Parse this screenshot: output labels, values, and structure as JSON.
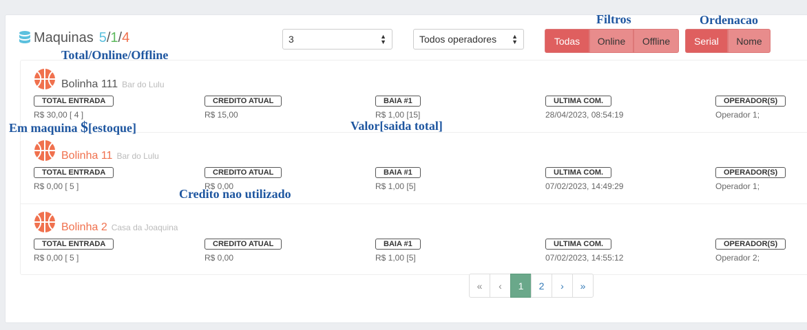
{
  "header": {
    "title": "Maquinas",
    "count_total": "5",
    "count_online": "1",
    "count_offline": "4",
    "separator": "/"
  },
  "filters": {
    "quantity_select": "3",
    "operator_select": "Todos operadores",
    "status_buttons": [
      "Todas",
      "Online",
      "Offline"
    ],
    "order_buttons": [
      "Serial",
      "Nome"
    ]
  },
  "labels": {
    "total_entrada": "TOTAL ENTRADA",
    "credito_atual": "CREDITO ATUAL",
    "baia": "BAIA #1",
    "ultima_com": "ULTIMA COM.",
    "operadores": "OPERADOR(S)"
  },
  "machines": [
    {
      "name": "Bolinha 111",
      "location": "Bar do Lulu",
      "total_entrada": "R$ 30,00 [ 4 ]",
      "credito_atual": "R$ 15,00",
      "baia": "R$ 1,00 [15]",
      "ultima_com": "28/04/2023, 08:54:19",
      "operadores": "Operador 1;"
    },
    {
      "name": "Bolinha 11",
      "location": "Bar do Lulu",
      "total_entrada": "R$ 0,00 [ 5 ]",
      "credito_atual": "R$ 0,00",
      "baia": "R$ 1,00 [5]",
      "ultima_com": "07/02/2023, 14:49:29",
      "operadores": "Operador 1;"
    },
    {
      "name": "Bolinha 2",
      "location": "Casa da Joaquina",
      "total_entrada": "R$ 0,00 [ 5 ]",
      "credito_atual": "R$ 0,00",
      "baia": "R$ 1,00 [5]",
      "ultima_com": "07/02/2023, 14:55:12",
      "operadores": "Operador 2;"
    }
  ],
  "pagination": {
    "first": "«",
    "prev": "‹",
    "pages": [
      "1",
      "2"
    ],
    "next": "›",
    "last": "»"
  },
  "annotations": {
    "filtros": "Filtros",
    "ordenacao": "Ordenacao",
    "total_online_offline": "Total/Online/Offline",
    "em_maquina": "Em maquina",
    "dollar": "$",
    "estoque": "[estoque]",
    "valor": "Valor[saida total]",
    "credito": "Credito nao utilizado"
  },
  "colors": {
    "accent_total": "#5bc0de",
    "accent_online": "#5cb85c",
    "accent_offline": "#f0714e",
    "button_active": "#df5f5f",
    "button_inactive": "#e88c8c",
    "page_current": "#6aa88a",
    "annotation": "#1e56a0"
  },
  "icons": {
    "header": "database-icon",
    "machine": "basketball-icon"
  }
}
